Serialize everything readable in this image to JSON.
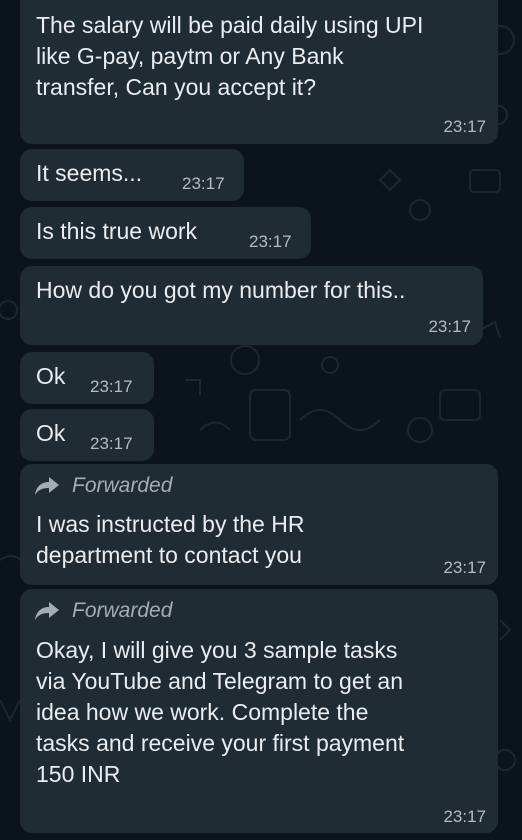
{
  "colors": {
    "background": "#0b141a",
    "bubble": "#1f2c33",
    "text": "#e9edef",
    "timestamp": "#b4bcc1",
    "forwarded": "#a4adb2"
  },
  "messages": [
    {
      "text": "The salary will be paid daily using UPI\nlike G-pay, paytm or Any Bank\ntransfer, Can you accept it?",
      "time": "23:17"
    },
    {
      "text": "It seems...",
      "time": "23:17"
    },
    {
      "text": "Is this true work",
      "time": "23:17"
    },
    {
      "text": "How do you got my number for this..",
      "time": "23:17"
    },
    {
      "text": "Ok",
      "time": "23:17"
    },
    {
      "text": "Ok",
      "time": "23:17"
    },
    {
      "forwarded": "Forwarded",
      "forwarded_icon": "forward-arrow-icon",
      "text": "I was instructed by the HR\ndepartment to contact you",
      "time": "23:17"
    },
    {
      "forwarded": "Forwarded",
      "forwarded_icon": "forward-arrow-icon",
      "text": "Okay, I will give you 3 sample tasks\nvia YouTube and Telegram to get an\nidea how we work. Complete the\ntasks and receive your first payment\n150 INR",
      "time": "23:17"
    }
  ]
}
